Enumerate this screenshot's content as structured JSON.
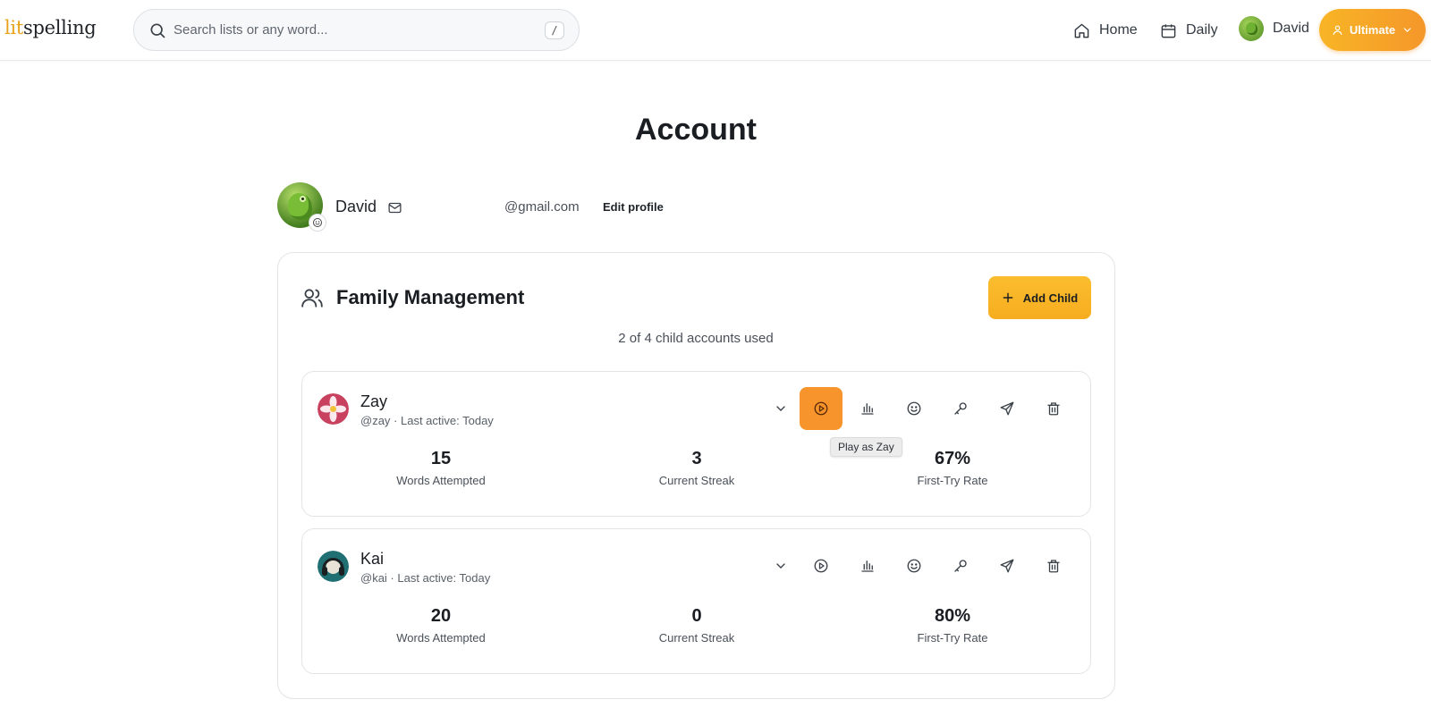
{
  "header": {
    "logo_lit": "lit",
    "logo_spelling": "spelling",
    "search_placeholder": "Search lists or any word...",
    "search_shortcut": "/",
    "nav": {
      "home": "Home",
      "daily": "Daily",
      "user": "David"
    },
    "plan_label": "Ultimate"
  },
  "page": {
    "title": "Account"
  },
  "profile": {
    "name": "David",
    "email": "@gmail.com",
    "edit_label": "Edit profile"
  },
  "family": {
    "title": "Family Management",
    "add_child_label": "Add Child",
    "accounts_used": "2 of 4 child accounts used",
    "children": [
      {
        "name": "Zay",
        "sub": "@zay · Last active: Today",
        "stats": [
          {
            "value": "15",
            "label": "Words Attempted"
          },
          {
            "value": "3",
            "label": "Current Streak"
          },
          {
            "value": "67%",
            "label": "First-Try Rate"
          }
        ],
        "tooltip": "Play as Zay"
      },
      {
        "name": "Kai",
        "sub": "@kai · Last active: Today",
        "stats": [
          {
            "value": "20",
            "label": "Words Attempted"
          },
          {
            "value": "0",
            "label": "Current Streak"
          },
          {
            "value": "80%",
            "label": "First-Try Rate"
          }
        ]
      }
    ]
  },
  "colors": {
    "accent_orange": "#f7952c",
    "accent_yellow": "#fbbd2e",
    "brand_gold": "#e8a21a"
  },
  "icons": [
    "search-icon",
    "home-icon",
    "calendar-icon",
    "user-icon",
    "chevron-down-icon",
    "mail-icon",
    "smiley-icon",
    "users-icon",
    "plus-icon",
    "play-icon",
    "bar-chart-icon",
    "key-icon",
    "send-icon",
    "trash-icon"
  ]
}
